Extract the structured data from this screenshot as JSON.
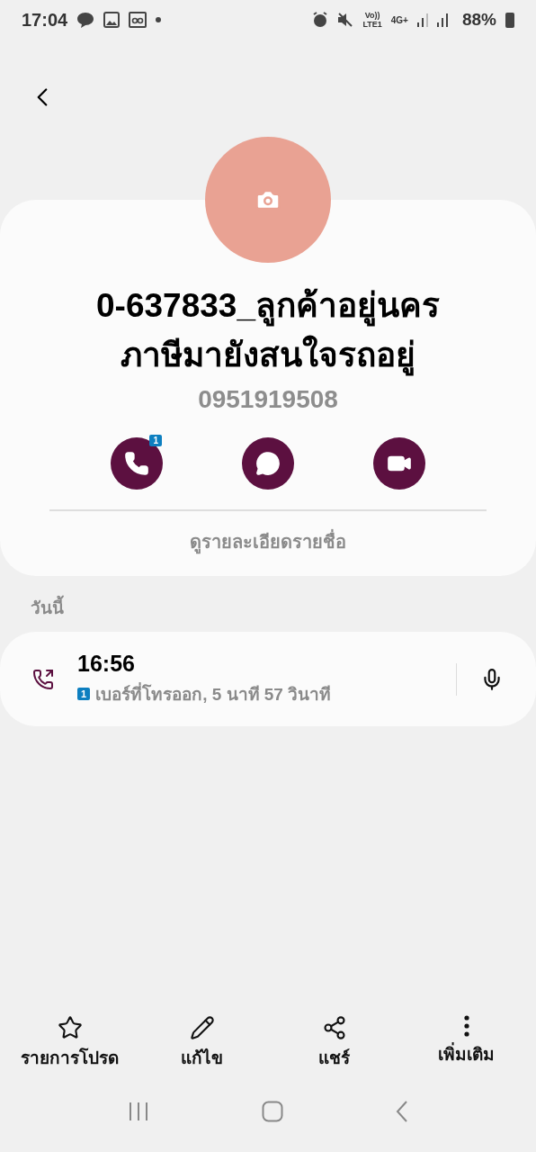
{
  "status_bar": {
    "time": "17:04",
    "volte": "Vo))",
    "lte": "LTE1",
    "network": "4G+",
    "battery": "88%"
  },
  "contact": {
    "name_lines": [
      "0-637833_ลูกค้าอยู่นคร",
      "ภาษีมายังสนใจรถอยู่"
    ],
    "phone": "0951919508",
    "actions": [
      {
        "kind": "call",
        "badge": "1"
      },
      {
        "kind": "message"
      },
      {
        "kind": "video"
      }
    ],
    "details_link": "ดูรายละเอียดรายชื่อ"
  },
  "history": {
    "heading": "วันนี้",
    "calls": [
      {
        "kind": "outgoing",
        "time": "16:56",
        "sim": "1",
        "detail": "เบอร์ที่โทรออก, 5 นาที 57 วินาที"
      }
    ]
  },
  "bottom_actions": [
    {
      "kind": "favorite",
      "label": "รายการโปรด"
    },
    {
      "kind": "edit",
      "label": "แก้ไข"
    },
    {
      "kind": "share",
      "label": "แชร์"
    },
    {
      "kind": "more",
      "label": "เพิ่มเติม"
    }
  ]
}
